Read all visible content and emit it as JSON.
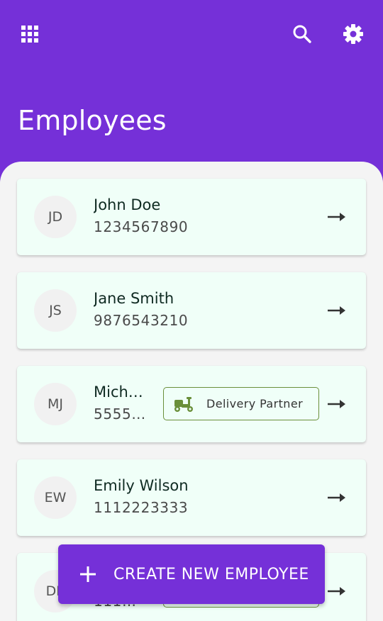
{
  "app_bar": {
    "title": "Employees",
    "icons": [
      "apps-grid-icon",
      "search-icon",
      "gear-icon"
    ],
    "background": "#7530d8"
  },
  "employees": [
    {
      "initials": "JD",
      "name": "John Doe",
      "phone": "1234567890"
    },
    {
      "initials": "JS",
      "name": "Jane Smith",
      "phone": "9876543210"
    },
    {
      "initials": "MJ",
      "name": "Mich…",
      "phone": "5555…",
      "role": "Delivery Partner",
      "role_icon": "scooter-icon"
    },
    {
      "initials": "EW",
      "name": "Emily Wilson",
      "phone": "1112223333"
    },
    {
      "initials": "DE",
      "name": "",
      "phone": "111…",
      "role": "",
      "role_icon": ""
    }
  ],
  "fab": {
    "label": "CREATE NEW EMPLOYEE",
    "icon": "plus-icon"
  },
  "colors": {
    "accent": "#7530d8",
    "card_bg": "#f0fff8",
    "chip_border": "#6a8f3a",
    "list_bg": "#f4f4f4"
  }
}
